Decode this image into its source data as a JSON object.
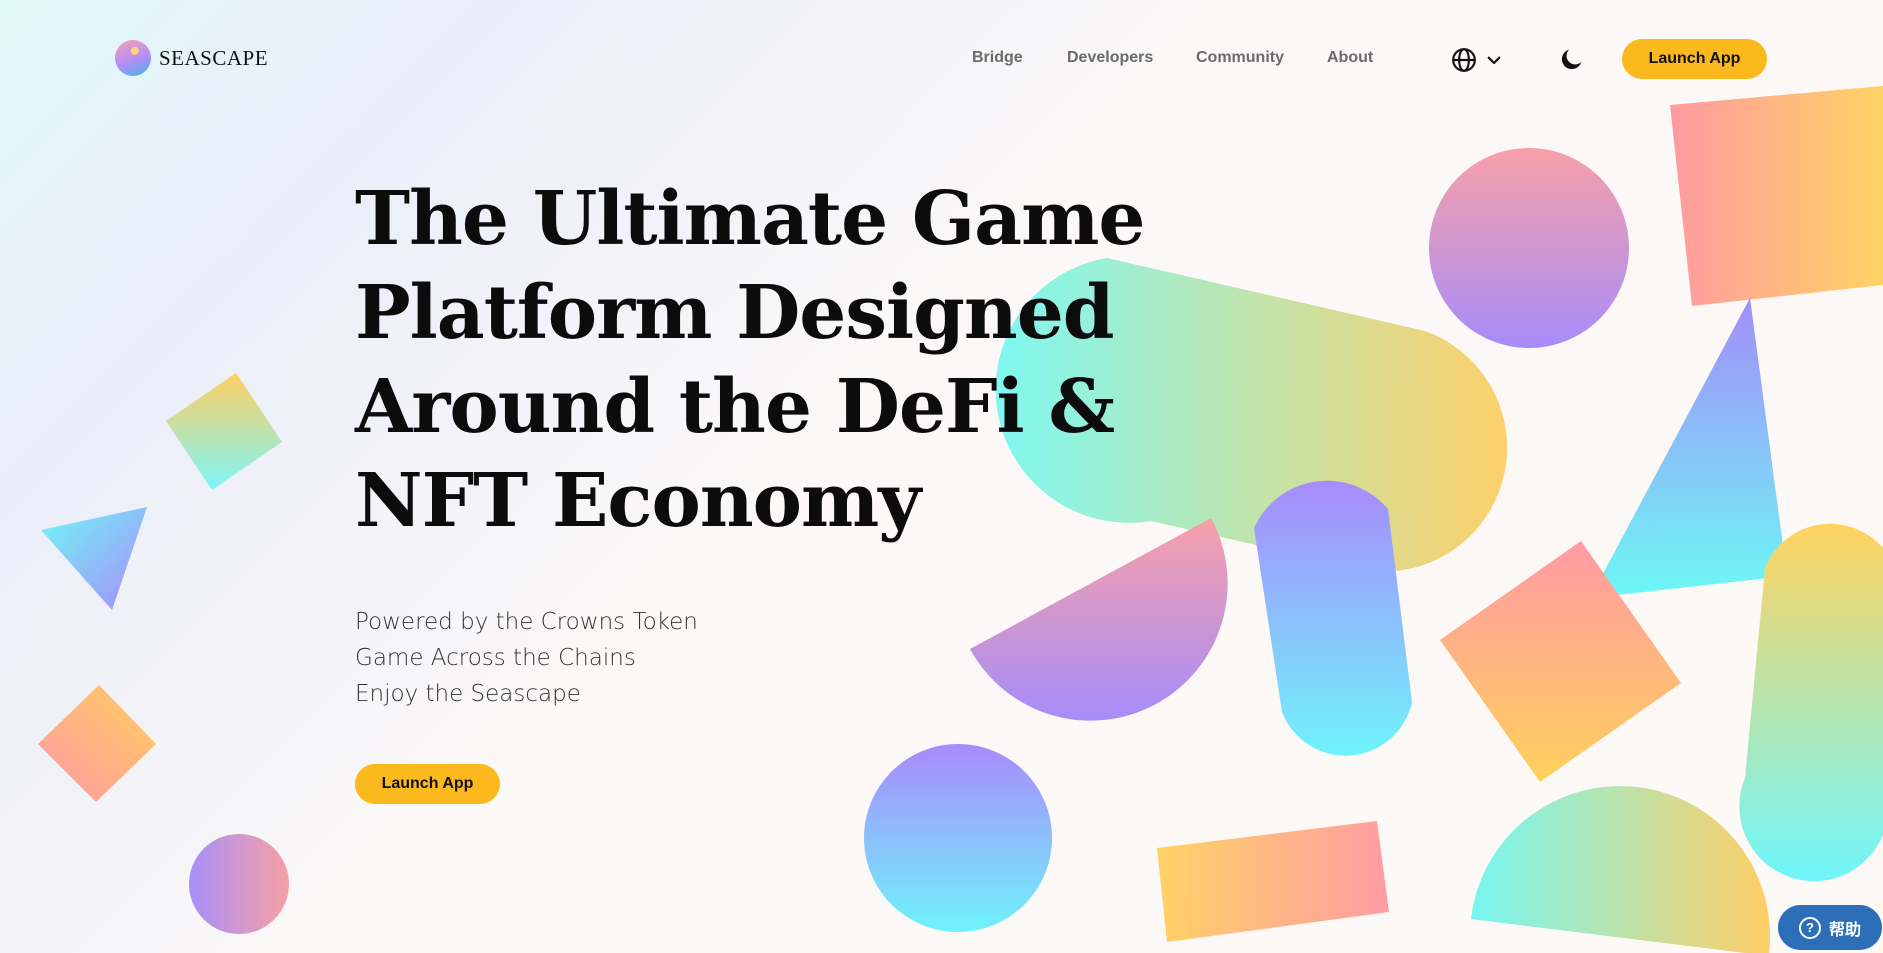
{
  "brand": {
    "name": "SEASCAPE"
  },
  "nav": {
    "items": [
      "Bridge",
      "Developers",
      "Community",
      "About"
    ]
  },
  "header": {
    "launch_label": "Launch App",
    "language_icon": "globe-icon",
    "theme_icon": "moon-icon"
  },
  "hero": {
    "title_lines": [
      "The Ultimate Game",
      "Platform Designed",
      "Around the DeFi &",
      "NFT Economy"
    ],
    "taglines": [
      "Powered by the Crowns Token",
      "Game Across the Chains",
      "Enjoy the Seascape"
    ],
    "cta_label": "Launch App"
  },
  "help": {
    "label": "帮助"
  },
  "colors": {
    "accent": "#fbb91e",
    "help_bg": "#2c6fb8",
    "text": "#0c0c0c",
    "nav_text": "#6b6b6b"
  }
}
